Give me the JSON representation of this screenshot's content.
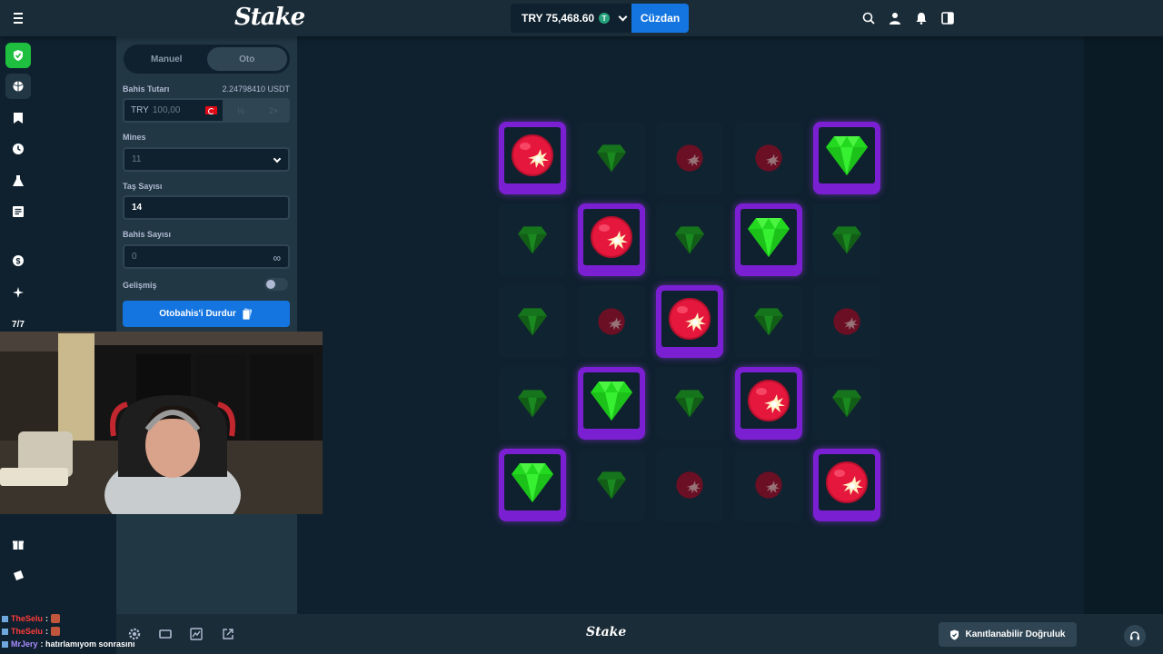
{
  "topbar": {
    "logo": "Stake",
    "balance": "TRY 75,468.60",
    "coin_symbol": "T",
    "wallet_label": "Cüzdan",
    "icons": [
      "search-icon",
      "user-icon",
      "bell-icon",
      "sidebar-toggle-icon"
    ]
  },
  "rail": {
    "items": [
      "shield-icon",
      "basketball-icon",
      "bookmark-icon",
      "clock-icon",
      "flask-icon",
      "newspaper-icon",
      "coin-icon",
      "sparkle-icon",
      "dice-icon",
      "gift-icon",
      "ticket-icon"
    ]
  },
  "panel": {
    "tabs": [
      {
        "label": "Manuel"
      },
      {
        "label": "Oto"
      }
    ],
    "bet_label": "Bahis Tutarı",
    "bet_usdt": "2.24798410 USDT",
    "bet_currency": "TRY",
    "bet_placeholder": "100,00",
    "half": "½",
    "double": "2×",
    "mines_label": "Mines",
    "mines_value": "11",
    "gems_label": "Taş Sayısı",
    "gems_value": "14",
    "bets_label": "Bahis Sayısı",
    "bets_value": "0",
    "infinity": "∞",
    "advanced_label": "Gelişmiş",
    "stop_label": "Otobahis'i Durdur"
  },
  "game": {
    "grid": [
      [
        "mine-selected",
        "gem",
        "mine",
        "mine",
        "gem-selected"
      ],
      [
        "gem",
        "mine-selected",
        "gem",
        "gem-selected",
        "gem"
      ],
      [
        "gem",
        "mine",
        "mine-selected",
        "gem",
        "mine"
      ],
      [
        "gem",
        "gem-selected",
        "gem",
        "mine-selected",
        "gem"
      ],
      [
        "gem-selected",
        "gem",
        "mine",
        "mine",
        "mine-selected"
      ]
    ],
    "colors": {
      "gem": "#22d91f",
      "mine": "#e5173c",
      "selected": "#7a1fd2"
    }
  },
  "bottombar": {
    "logo": "Stake",
    "fair_label": "Kanıtlanabilir Doğruluk",
    "icons": [
      "settings-icon",
      "theatre-icon",
      "stats-icon",
      "popout-icon"
    ]
  },
  "chat": [
    {
      "user": "TheSelu",
      "msg": ":",
      "color": "red",
      "emote": true
    },
    {
      "user": "TheSelu",
      "msg": ":",
      "color": "red",
      "emote": true
    },
    {
      "user": "MrJery",
      "msg": ": hatırlamıyom sonrasını",
      "color": "purple",
      "emote": false
    }
  ]
}
